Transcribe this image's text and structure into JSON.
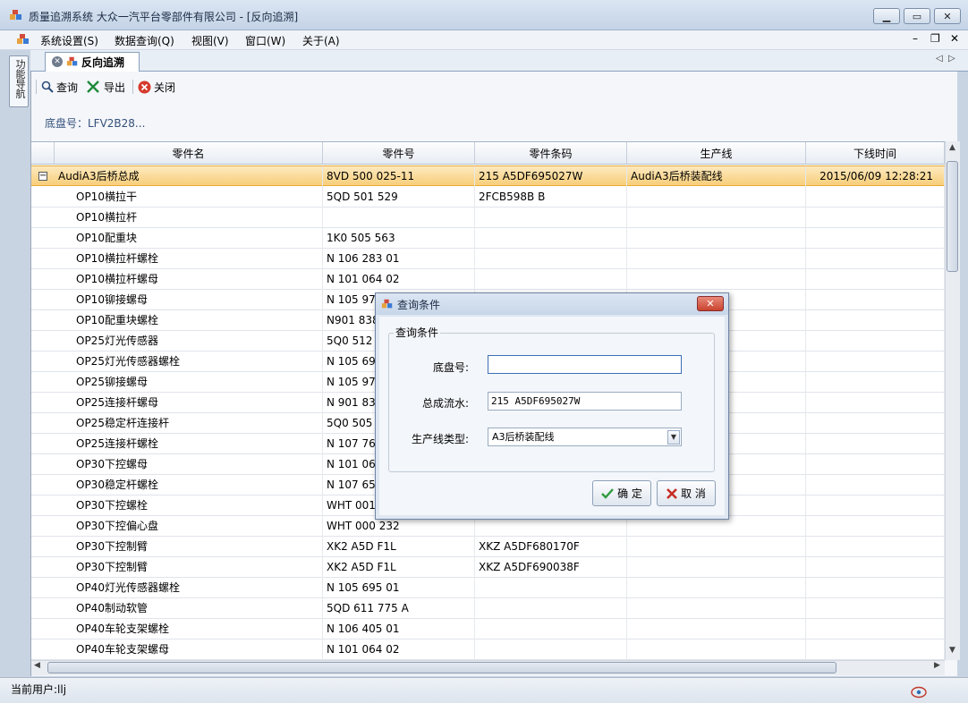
{
  "window": {
    "title": "质量追溯系统  大众一汽平台零部件有限公司 - [反向追溯]"
  },
  "menu": [
    "系统设置(S)",
    "数据查询(Q)",
    "视图(V)",
    "窗口(W)",
    "关于(A)"
  ],
  "nav_tab": "功能导航",
  "doc_tab": {
    "label": "反向追溯"
  },
  "toolbar": {
    "query": "查询",
    "export": "导出",
    "close": "关闭"
  },
  "chassis_label": "底盘号：LFV2B28...",
  "grid": {
    "headers": [
      "零件名",
      "零件号",
      "零件条码",
      "生产线",
      "下线时间"
    ],
    "parent": {
      "name": "AudiA3后桥总成",
      "part_no": "8VD 500 025-11",
      "barcode": "215 A5DF695027W",
      "line": "AudiA3后桥装配线",
      "time": "2015/06/09 12:28:21"
    },
    "rows": [
      {
        "name": "OP10横拉干",
        "part_no": "5QD 501 529",
        "barcode": "2FCB598B B"
      },
      {
        "name": "OP10横拉杆",
        "part_no": "",
        "barcode": ""
      },
      {
        "name": "OP10配重块",
        "part_no": "1K0 505 563",
        "barcode": ""
      },
      {
        "name": "OP10横拉杆螺栓",
        "part_no": "N 106 283 01",
        "barcode": ""
      },
      {
        "name": "OP10横拉杆螺母",
        "part_no": "N 101 064 02",
        "barcode": ""
      },
      {
        "name": "OP10铆接螺母",
        "part_no": "N 105 977",
        "barcode": ""
      },
      {
        "name": "OP10配重块螺栓",
        "part_no": "N901 838",
        "barcode": ""
      },
      {
        "name": "OP25灯光传感器",
        "part_no": "5Q0 512 5",
        "barcode": ""
      },
      {
        "name": "OP25灯光传感器螺栓",
        "part_no": "N 105 695",
        "barcode": ""
      },
      {
        "name": "OP25铆接螺母",
        "part_no": "N 105 977",
        "barcode": ""
      },
      {
        "name": "OP25连接杆螺母",
        "part_no": "N 901 838",
        "barcode": ""
      },
      {
        "name": "OP25稳定杆连接杆",
        "part_no": "5Q0 505 4",
        "barcode": ""
      },
      {
        "name": "OP25连接杆螺栓",
        "part_no": "N 107 765",
        "barcode": ""
      },
      {
        "name": "OP30下控螺母",
        "part_no": "N 101 064",
        "barcode": ""
      },
      {
        "name": "OP30稳定杆螺栓",
        "part_no": "N 107 658",
        "barcode": ""
      },
      {
        "name": "OP30下控螺栓",
        "part_no": "WHT 001",
        "barcode": ""
      },
      {
        "name": "OP30下控偏心盘",
        "part_no": "WHT 000 232",
        "barcode": ""
      },
      {
        "name": "OP30下控制臂",
        "part_no": "XK2 A5D F1L",
        "barcode": "XKZ A5DF680170F"
      },
      {
        "name": "OP30下控制臂",
        "part_no": "XK2 A5D F1L",
        "barcode": "XKZ A5DF690038F"
      },
      {
        "name": "OP40灯光传感器螺栓",
        "part_no": "N 105 695 01",
        "barcode": ""
      },
      {
        "name": "OP40制动软管",
        "part_no": "5QD 611 775 A",
        "barcode": ""
      },
      {
        "name": "OP40车轮支架螺栓",
        "part_no": "N 106 405 01",
        "barcode": ""
      },
      {
        "name": "OP40车轮支架螺母",
        "part_no": "N 101 064 02",
        "barcode": ""
      }
    ]
  },
  "status": "当前用户:llj",
  "dialog": {
    "title": "查询条件",
    "group_title": "查询条件",
    "chassis_label": "底盘号:",
    "chassis_value": "",
    "serial_label": "总成流水:",
    "serial_value": "215 A5DF695027W",
    "line_label": "生产线类型:",
    "line_value": "A3后桥装配线",
    "ok": "确 定",
    "cancel": "取 消"
  },
  "colors": {
    "selected_row": "#f8cf7a",
    "accent": "#2b6cb0"
  }
}
